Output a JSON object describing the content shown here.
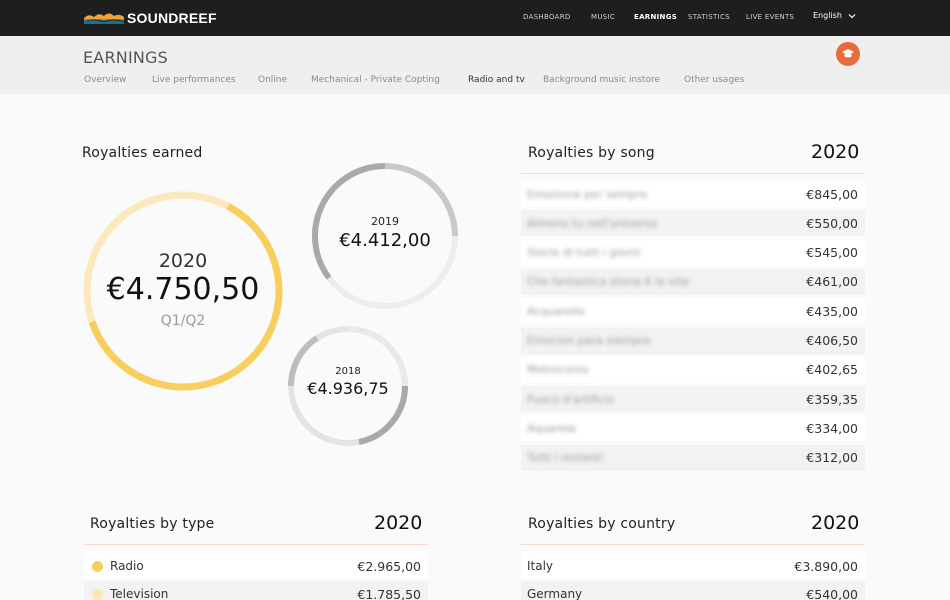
{
  "app": {
    "brand": "SOUNDREEF"
  },
  "nav": {
    "items": [
      {
        "label": "DASHBOARD",
        "active": false
      },
      {
        "label": "MUSIC",
        "active": false
      },
      {
        "label": "EARNINGS",
        "active": true
      },
      {
        "label": "STATISTICS",
        "active": false
      },
      {
        "label": "LIVE EVENTS",
        "active": false
      }
    ],
    "language": "English"
  },
  "header": {
    "title": "EARNINGS",
    "tabs": [
      {
        "label": "Overview",
        "active": false
      },
      {
        "label": "Live performances",
        "active": false
      },
      {
        "label": "Online",
        "active": false
      },
      {
        "label": "Mechanical - Private Copting",
        "active": false
      },
      {
        "label": "Radio and tv",
        "active": true
      },
      {
        "label": "Background music instore",
        "active": false
      },
      {
        "label": "Other usages",
        "active": false
      }
    ],
    "action_icon": "graduation-cap-icon"
  },
  "royalties_earned": {
    "title": "Royalties earned",
    "main": {
      "year": "2020",
      "amount": "€4.750,50",
      "period": "Q1/Q2",
      "progress": 0.62
    },
    "secondary": [
      {
        "year": "2019",
        "amount": "€4.412,00"
      },
      {
        "year": "2018",
        "amount": "€4.936,75"
      }
    ]
  },
  "royalties_by_song": {
    "title": "Royalties by song",
    "year": "2020",
    "rows": [
      {
        "label": "Emozione per sempre",
        "value": "€845,00"
      },
      {
        "label": "Almeno tu nell'universo",
        "value": "€550,00"
      },
      {
        "label": "Storie di tutti i giorni",
        "value": "€545,00"
      },
      {
        "label": "Che fantastica storia è la vita",
        "value": "€461,00"
      },
      {
        "label": "Acquarello",
        "value": "€435,00"
      },
      {
        "label": "Emocion para siempre",
        "value": "€406,50"
      },
      {
        "label": "Metrocomo",
        "value": "€402,65"
      },
      {
        "label": "Fuoco d'artificio",
        "value": "€359,35"
      },
      {
        "label": "Aquarela",
        "value": "€334,00"
      },
      {
        "label": "Tutti i restanti",
        "value": "€312,00"
      }
    ]
  },
  "royalties_by_type": {
    "title": "Royalties by type",
    "year": "2020",
    "rows": [
      {
        "label": "Radio",
        "value": "€2.965,00",
        "color": "#f8cf5e"
      },
      {
        "label": "Television",
        "value": "€1.785,50",
        "color": "#fbe7b3"
      }
    ]
  },
  "royalties_by_country": {
    "title": "Royalties by country",
    "year": "2020",
    "rows": [
      {
        "label": "Italy",
        "value": "€3.890,00"
      },
      {
        "label": "Germany",
        "value": "€540,00"
      }
    ]
  },
  "colors": {
    "accent": "#e96a3a",
    "gold": "#f8cf5e",
    "gold_light": "#fbe9bd",
    "gray_dark": "#a9a9a9",
    "gray_light": "#e4e4e4"
  }
}
